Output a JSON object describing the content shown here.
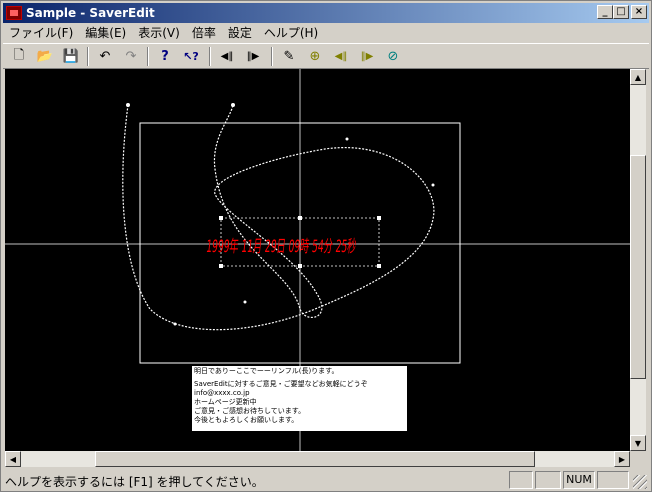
{
  "window": {
    "title": "Sample - SaverEdit",
    "minimize_glyph": "_",
    "maximize_glyph": "□",
    "close_glyph": "×"
  },
  "menu": [
    {
      "label": "ファイル(F)"
    },
    {
      "label": "編集(E)"
    },
    {
      "label": "表示(V)"
    },
    {
      "label": "倍率"
    },
    {
      "label": "設定"
    },
    {
      "label": "ヘルプ(H)"
    }
  ],
  "toolbar": [
    {
      "name": "new-file-icon",
      "glyph": "🗋"
    },
    {
      "name": "open-file-icon",
      "glyph": "📂"
    },
    {
      "name": "save-file-icon",
      "glyph": "💾"
    },
    {
      "name": "undo-icon",
      "glyph": "↶"
    },
    {
      "name": "redo-icon",
      "glyph": "↷"
    },
    {
      "name": "help-icon",
      "glyph": "?"
    },
    {
      "name": "context-help-icon",
      "glyph": "↖?"
    },
    {
      "name": "rewind-icon",
      "glyph": "◀‖"
    },
    {
      "name": "play-icon",
      "glyph": "‖▶"
    },
    {
      "name": "edit-path-icon",
      "glyph": "✎"
    },
    {
      "name": "zoom-in-icon",
      "glyph": "⊕"
    },
    {
      "name": "step-back-icon",
      "glyph": "◀‖"
    },
    {
      "name": "step-forward-icon",
      "glyph": "‖▶"
    },
    {
      "name": "zoom-out-icon",
      "glyph": "⊘"
    }
  ],
  "canvas": {
    "date_text": "1999年 11月 29日 09時 54分 25秒",
    "note_lines": [
      "明日でありーここでーーリンフル(長)ります。",
      "SaverEditに対するご意見・ご要望などお気軽にどうぞ",
      "info@xxxx.co.jp",
      "ホームページ更新中",
      "ご意見・ご感想お待ちしています。",
      "今後ともよろしくお願いします。"
    ]
  },
  "status": {
    "message": "ヘルプを表示するには [F1] を押してください。",
    "num": "NUM"
  },
  "colors": {
    "title_start": "#0a246a",
    "title_end": "#a6caf0",
    "canvas_bg": "#000000",
    "date_text": "#ff0000"
  }
}
